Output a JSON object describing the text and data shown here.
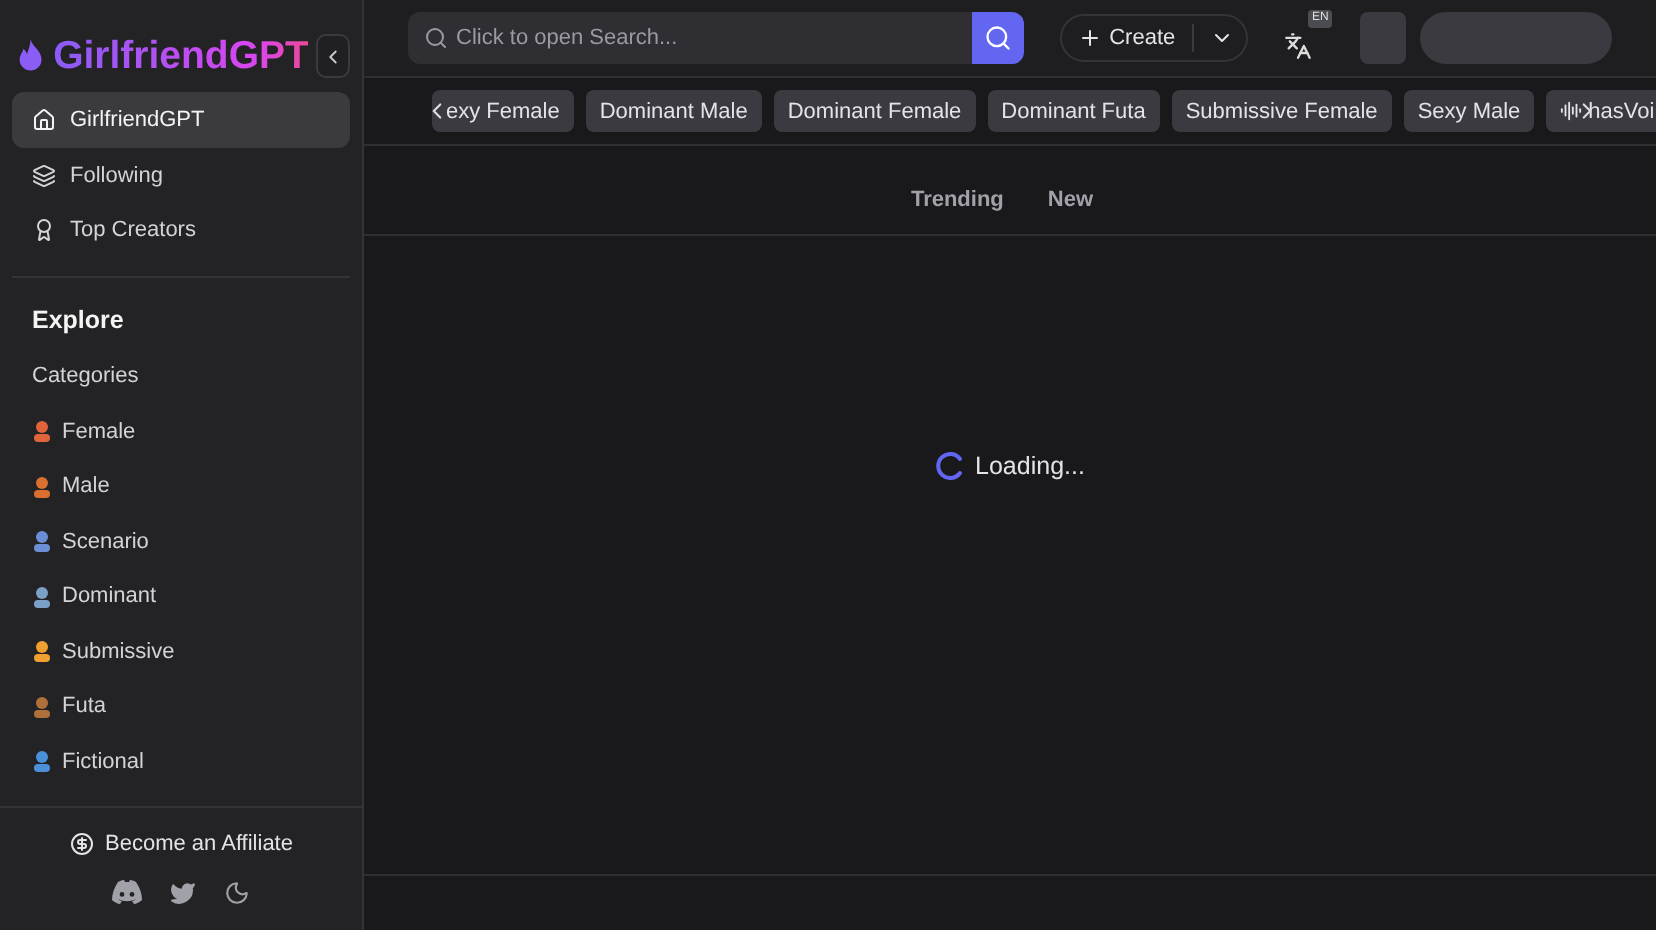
{
  "brand": {
    "name": "GirlfriendGPT"
  },
  "sidebar": {
    "nav": [
      {
        "label": "GirlfriendGPT",
        "selected": true,
        "kind": "home"
      },
      {
        "label": "Following",
        "selected": false,
        "kind": "stack"
      },
      {
        "label": "Top Creators",
        "selected": false,
        "kind": "award"
      }
    ],
    "section_title": "Explore",
    "categories_label": "Categories",
    "categories": [
      {
        "label": "Female",
        "color": "#e0653a"
      },
      {
        "label": "Male",
        "color": "#d9702f"
      },
      {
        "label": "Scenario",
        "color": "#6b8fd6"
      },
      {
        "label": "Dominant",
        "color": "#7aa0c8"
      },
      {
        "label": "Submissive",
        "color": "#f0a030"
      },
      {
        "label": "Futa",
        "color": "#b0703a"
      },
      {
        "label": "Fictional",
        "color": "#4a90d9"
      }
    ],
    "affiliate": "Become an Affiliate"
  },
  "header": {
    "search": {
      "placeholder": "Click to open Search..."
    },
    "create": "Create",
    "language": "EN"
  },
  "chips": [
    {
      "label": "exy Female",
      "kind": "plain"
    },
    {
      "label": "Dominant Male",
      "kind": "plain"
    },
    {
      "label": "Dominant Female",
      "kind": "plain"
    },
    {
      "label": "Dominant Futa",
      "kind": "plain"
    },
    {
      "label": "Submissive Female",
      "kind": "plain"
    },
    {
      "label": "Sexy Male",
      "kind": "plain"
    },
    {
      "label": "hasVoi",
      "kind": "voice"
    }
  ],
  "tabs": [
    {
      "label": "Trending",
      "selected": false
    },
    {
      "label": "New",
      "selected": false
    }
  ],
  "status": "Loading..."
}
